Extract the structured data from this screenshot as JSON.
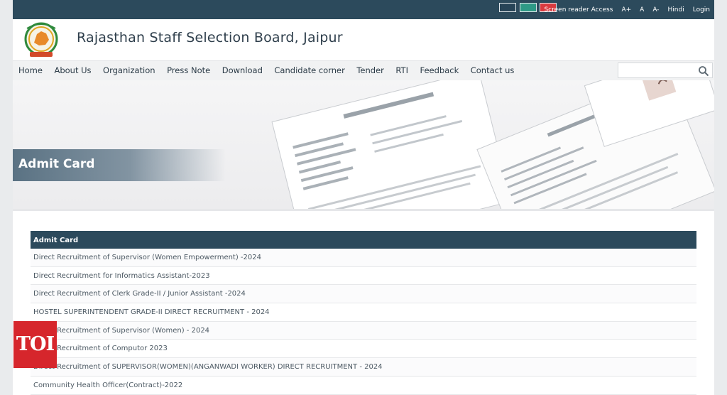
{
  "accessibility": {
    "swatches": [
      "#274457",
      "#2e9a86",
      "#d93a3f"
    ],
    "links": [
      "Screen reader Access",
      "A+",
      "A",
      "A-",
      "Hindi",
      "Login"
    ]
  },
  "header": {
    "title": "Rajasthan Staff Selection Board, Jaipur"
  },
  "nav": {
    "items": [
      "Home",
      "About Us",
      "Organization",
      "Press Note",
      "Download",
      "Candidate corner",
      "Tender",
      "RTI",
      "Feedback",
      "Contact us"
    ],
    "search_placeholder": ""
  },
  "banner": {
    "title": "Admit Card"
  },
  "table": {
    "header": "Admit Card",
    "rows": [
      "Direct Recruitment of Supervisor (Women Empowerment) -2024",
      "Direct Recruitment for Informatics Assistant-2023",
      "Direct Recruitment of Clerk Grade-II / Junior Assistant -2024",
      "HOSTEL SUPERINTENDENT GRADE-II DIRECT RECRUITMENT - 2024",
      "Direct Recruitment of Supervisor (Women) - 2024",
      "Direct Recruitment of Computor 2023",
      "Direct Recruitment of SUPERVISOR(WOMEN)(ANGANWADI WORKER) DIRECT RECRUITMENT - 2024",
      "Community Health Officer(Contract)-2022"
    ]
  },
  "watermark": {
    "text": "TOI"
  },
  "colors": {
    "bar": "#2c4a5c",
    "watermark": "#d6262c"
  }
}
